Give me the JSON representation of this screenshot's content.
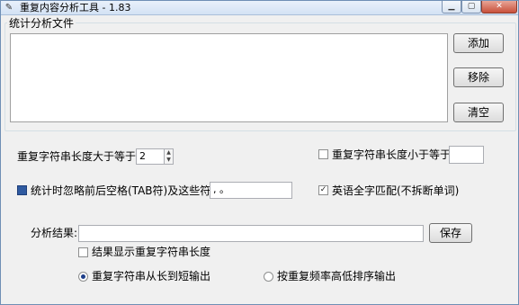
{
  "window": {
    "title": "重复内容分析工具 - 1.83",
    "app_icon": "text-file-icon",
    "controls": {
      "minimize": "minimize-icon",
      "maximize": "maximize-icon",
      "close": "close-icon"
    }
  },
  "files_group": {
    "label": "统计分析文件"
  },
  "buttons": {
    "add": "添加",
    "remove": "移除",
    "clear": "清空",
    "save": "保存"
  },
  "options": {
    "min_length_label": "重复字符串长度大于等于:",
    "min_length_value": "2",
    "max_length_label": "重复字符串长度小于等于:",
    "max_length_value": "",
    "ignore_label": "统计时忽略前后空格(TAB符)及这些符号:",
    "ignore_value": ", 。",
    "english_label": "英语全字匹配(不拆断单词)"
  },
  "result": {
    "label": "分析结果:",
    "path_value": "",
    "show_length_label": "结果显示重复字符串长度",
    "sort_by_length_label": "重复字符串从长到短输出",
    "sort_by_frequency_label": "按重复频率高低排序输出"
  }
}
